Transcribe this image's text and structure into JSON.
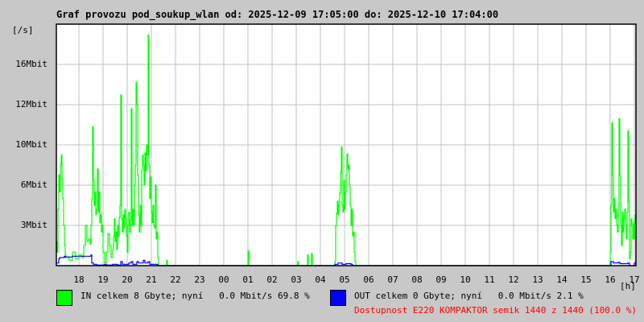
{
  "title": "Graf provozu pod_soukup_wlan od: 2025-12-09 17:05:00 do: 2025-12-10 17:04:00",
  "chart_data": {
    "type": "line",
    "title": "Graf provozu pod_soukup_wlan od: 2025-12-09 17:05:00 do: 2025-12-10 17:04:00",
    "ylabel": "[/s]",
    "xlabel": "[h]",
    "x_unit": "minutes since 17:04",
    "x_range": [
      0,
      1440
    ],
    "y_ticks": [
      {
        "value": 3,
        "label": "3Mbit"
      },
      {
        "value": 6,
        "label": "6Mbit"
      },
      {
        "value": 10,
        "label": "10Mbit"
      },
      {
        "value": 12,
        "label": "12Mbit"
      },
      {
        "value": 16,
        "label": "16Mbit"
      }
    ],
    "y_max": 20,
    "x_ticks": [
      {
        "t": 56,
        "label": "18"
      },
      {
        "t": 116,
        "label": "19"
      },
      {
        "t": 176,
        "label": "20"
      },
      {
        "t": 236,
        "label": "21"
      },
      {
        "t": 296,
        "label": "22"
      },
      {
        "t": 356,
        "label": "23"
      },
      {
        "t": 416,
        "label": "00"
      },
      {
        "t": 476,
        "label": "01"
      },
      {
        "t": 536,
        "label": "02"
      },
      {
        "t": 596,
        "label": "03"
      },
      {
        "t": 656,
        "label": "04"
      },
      {
        "t": 716,
        "label": "05"
      },
      {
        "t": 776,
        "label": "06"
      },
      {
        "t": 836,
        "label": "07"
      },
      {
        "t": 896,
        "label": "08"
      },
      {
        "t": 956,
        "label": "09"
      },
      {
        "t": 1016,
        "label": "10"
      },
      {
        "t": 1076,
        "label": "11"
      },
      {
        "t": 1136,
        "label": "12"
      },
      {
        "t": 1196,
        "label": "13"
      },
      {
        "t": 1256,
        "label": "14"
      },
      {
        "t": 1316,
        "label": "15"
      },
      {
        "t": 1376,
        "label": "16"
      },
      {
        "t": 1436,
        "label": "17"
      }
    ],
    "grid": true,
    "series": [
      {
        "name": "IN",
        "color": "#00ff00",
        "unit": "Mbit/s",
        "points": [
          [
            0,
            1.8
          ],
          [
            2,
            1.0
          ],
          [
            4,
            4.2
          ],
          [
            6,
            7.0
          ],
          [
            8,
            5.5
          ],
          [
            10,
            8.0
          ],
          [
            12,
            9.0
          ],
          [
            14,
            6.5
          ],
          [
            16,
            5.0
          ],
          [
            18,
            3.0
          ],
          [
            20,
            1.5
          ],
          [
            22,
            0.8
          ],
          [
            24,
            0.6
          ],
          [
            32,
            0.4
          ],
          [
            40,
            1.0
          ],
          [
            48,
            0.5
          ],
          [
            56,
            0.8
          ],
          [
            64,
            0.6
          ],
          [
            68,
            1.5
          ],
          [
            72,
            3.0
          ],
          [
            76,
            1.8
          ],
          [
            80,
            2.0
          ],
          [
            84,
            1.6
          ],
          [
            86,
            3.0
          ],
          [
            88,
            5.0
          ],
          [
            90,
            10.9
          ],
          [
            92,
            6.5
          ],
          [
            94,
            4.5
          ],
          [
            96,
            5.5
          ],
          [
            98,
            3.8
          ],
          [
            100,
            4.2
          ],
          [
            102,
            7.6
          ],
          [
            104,
            4.0
          ],
          [
            106,
            5.5
          ],
          [
            108,
            3.2
          ],
          [
            110,
            3.8
          ],
          [
            112,
            2.5
          ],
          [
            114,
            3.0
          ],
          [
            116,
            1.0
          ],
          [
            120,
            0.2
          ],
          [
            124,
            1.0
          ],
          [
            128,
            2.4
          ],
          [
            132,
            1.5
          ],
          [
            136,
            0.6
          ],
          [
            140,
            1.2
          ],
          [
            142,
            2.2
          ],
          [
            144,
            3.5
          ],
          [
            146,
            1.8
          ],
          [
            148,
            2.5
          ],
          [
            150,
            1.2
          ],
          [
            152,
            3.0
          ],
          [
            154,
            2.2
          ],
          [
            156,
            3.6
          ],
          [
            158,
            4.5
          ],
          [
            160,
            12.96
          ],
          [
            162,
            3.5
          ],
          [
            164,
            2.5
          ],
          [
            166,
            3.8
          ],
          [
            168,
            2.8
          ],
          [
            170,
            4.2
          ],
          [
            172,
            3.5
          ],
          [
            174,
            2.2
          ],
          [
            176,
            1.0
          ],
          [
            178,
            3.0
          ],
          [
            180,
            4.0
          ],
          [
            182,
            2.5
          ],
          [
            184,
            3.4
          ],
          [
            186,
            11.8
          ],
          [
            188,
            3.0
          ],
          [
            190,
            4.2
          ],
          [
            192,
            3.0
          ],
          [
            194,
            6.0
          ],
          [
            196,
            8.0
          ],
          [
            198,
            14.2
          ],
          [
            200,
            12.0
          ],
          [
            202,
            7.0
          ],
          [
            204,
            3.8
          ],
          [
            206,
            2.5
          ],
          [
            208,
            4.5
          ],
          [
            210,
            3.0
          ],
          [
            212,
            7.5
          ],
          [
            214,
            9.0
          ],
          [
            216,
            8.0
          ],
          [
            218,
            6.0
          ],
          [
            220,
            9.2
          ],
          [
            222,
            7.4
          ],
          [
            224,
            10.0
          ],
          [
            226,
            9.0
          ],
          [
            228,
            18.9
          ],
          [
            230,
            8.0
          ],
          [
            232,
            5.0
          ],
          [
            234,
            6.8
          ],
          [
            236,
            4.0
          ],
          [
            238,
            3.2
          ],
          [
            240,
            4.5
          ],
          [
            242,
            3.0
          ],
          [
            244,
            2.8
          ],
          [
            246,
            6.0
          ],
          [
            248,
            2.0
          ],
          [
            250,
            2.5
          ],
          [
            252,
            0.6
          ],
          [
            254,
            0
          ],
          [
            272,
            0
          ],
          [
            274,
            0.4
          ],
          [
            276,
            0
          ],
          [
            474,
            0
          ],
          [
            476,
            1.1
          ],
          [
            478,
            0
          ],
          [
            598,
            0
          ],
          [
            600,
            0.3
          ],
          [
            602,
            0
          ],
          [
            622,
            0
          ],
          [
            624,
            0.8
          ],
          [
            626,
            0
          ],
          [
            632,
            0
          ],
          [
            634,
            0.9
          ],
          [
            636,
            0
          ],
          [
            690,
            0
          ],
          [
            692,
            0.3
          ],
          [
            694,
            3.0
          ],
          [
            696,
            3.9
          ],
          [
            698,
            4.8
          ],
          [
            700,
            3.8
          ],
          [
            702,
            4.5
          ],
          [
            704,
            5.4
          ],
          [
            706,
            7.2
          ],
          [
            708,
            9.8
          ],
          [
            710,
            4.5
          ],
          [
            712,
            4.0
          ],
          [
            714,
            6.5
          ],
          [
            716,
            4.2
          ],
          [
            718,
            5.5
          ],
          [
            720,
            7.0
          ],
          [
            722,
            9.1
          ],
          [
            724,
            7.6
          ],
          [
            726,
            8.0
          ],
          [
            728,
            6.0
          ],
          [
            730,
            4.5
          ],
          [
            732,
            3.0
          ],
          [
            734,
            4.2
          ],
          [
            736,
            2.2
          ],
          [
            738,
            2.5
          ],
          [
            740,
            1.0
          ],
          [
            742,
            0.3
          ],
          [
            744,
            0
          ],
          [
            1374,
            0
          ],
          [
            1376,
            1.0
          ],
          [
            1378,
            4.5
          ],
          [
            1380,
            11.1
          ],
          [
            1382,
            7.0
          ],
          [
            1384,
            4.0
          ],
          [
            1386,
            5.0
          ],
          [
            1388,
            3.5
          ],
          [
            1390,
            4.2
          ],
          [
            1392,
            3.0
          ],
          [
            1394,
            2.5
          ],
          [
            1396,
            4.5
          ],
          [
            1398,
            11.3
          ],
          [
            1400,
            7.0
          ],
          [
            1402,
            3.0
          ],
          [
            1404,
            1.5
          ],
          [
            1406,
            4.0
          ],
          [
            1408,
            2.5
          ],
          [
            1410,
            3.5
          ],
          [
            1412,
            4.2
          ],
          [
            1414,
            3.0
          ],
          [
            1416,
            2.0
          ],
          [
            1418,
            4.0
          ],
          [
            1420,
            10.7
          ],
          [
            1422,
            4.8
          ],
          [
            1424,
            0.5
          ],
          [
            1426,
            1.0
          ],
          [
            1428,
            3.5
          ],
          [
            1430,
            3.0
          ],
          [
            1432,
            2.0
          ],
          [
            1434,
            3.2
          ],
          [
            1436,
            2.0
          ],
          [
            1438,
            3.8
          ]
        ]
      },
      {
        "name": "OUT",
        "color": "#0000ff",
        "unit": "Mbit/s",
        "points": [
          [
            0,
            0.2
          ],
          [
            4,
            0.2
          ],
          [
            6,
            0.5
          ],
          [
            8,
            0.6
          ],
          [
            20,
            0.7
          ],
          [
            22,
            0.65
          ],
          [
            40,
            0.7
          ],
          [
            60,
            0.7
          ],
          [
            86,
            0.8
          ],
          [
            88,
            0.2
          ],
          [
            92,
            0.1
          ],
          [
            100,
            0.05
          ],
          [
            116,
            0.05
          ],
          [
            120,
            0.1
          ],
          [
            124,
            0.05
          ],
          [
            140,
            0.1
          ],
          [
            152,
            0.05
          ],
          [
            160,
            0.3
          ],
          [
            164,
            0.1
          ],
          [
            180,
            0.2
          ],
          [
            186,
            0.3
          ],
          [
            190,
            0.1
          ],
          [
            200,
            0.3
          ],
          [
            204,
            0.2
          ],
          [
            216,
            0.4
          ],
          [
            220,
            0.2
          ],
          [
            228,
            0.3
          ],
          [
            232,
            0.1
          ],
          [
            248,
            0.1
          ],
          [
            252,
            0
          ],
          [
            690,
            0
          ],
          [
            692,
            0.1
          ],
          [
            700,
            0.2
          ],
          [
            710,
            0.1
          ],
          [
            720,
            0.15
          ],
          [
            732,
            0.1
          ],
          [
            736,
            0
          ],
          [
            1374,
            0
          ],
          [
            1378,
            0.3
          ],
          [
            1384,
            0.2
          ],
          [
            1396,
            0.25
          ],
          [
            1400,
            0.15
          ],
          [
            1420,
            0.2
          ],
          [
            1424,
            0
          ],
          [
            1436,
            0.2
          ],
          [
            1440,
            0
          ]
        ]
      }
    ]
  },
  "legend": {
    "in": {
      "text": "IN celkem 8 Gbyte; nyní   0.0 Mbit/s 69.8 %",
      "color": "#00ff00"
    },
    "out": {
      "text": "OUT celkem 0 Gbyte; nyní   0.0 Mbit/s 2.1 %",
      "color": "#0000ff"
    },
    "availability": {
      "text": "Dostupnost E220 KOMPAKTOR semik 1440 z 1440 (100.0 %)",
      "color": "#ff0000"
    }
  }
}
